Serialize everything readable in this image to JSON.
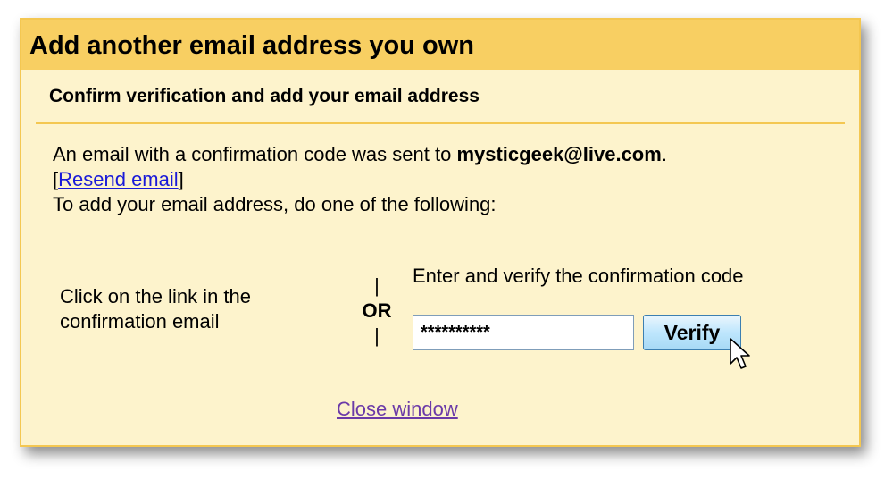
{
  "dialog": {
    "title": "Add another email address you own",
    "subtitle": "Confirm verification and add your email address",
    "message_prefix": "An email with a confirmation code was sent to ",
    "email": "mysticgeek@live.com",
    "message_suffix": ".",
    "resend_open": "[",
    "resend_link": "Resend email",
    "resend_close": "]",
    "instruction": "To add your email address, do one of the following:",
    "option_left": "Click on the link in the confirmation email",
    "or_bar_top": "|",
    "or_label": "OR",
    "or_bar_bottom": "|",
    "option_right": "Enter and verify the confirmation code",
    "code_value": "**********",
    "verify_label": "Verify",
    "close_link": "Close window"
  },
  "colors": {
    "background": "#fdf3cc",
    "titlebar": "#f8cf62",
    "border": "#f4c751",
    "link": "#1a1ad8",
    "visited_link": "#6b3aa8"
  },
  "icons": [
    "mouse-pointer-icon"
  ]
}
